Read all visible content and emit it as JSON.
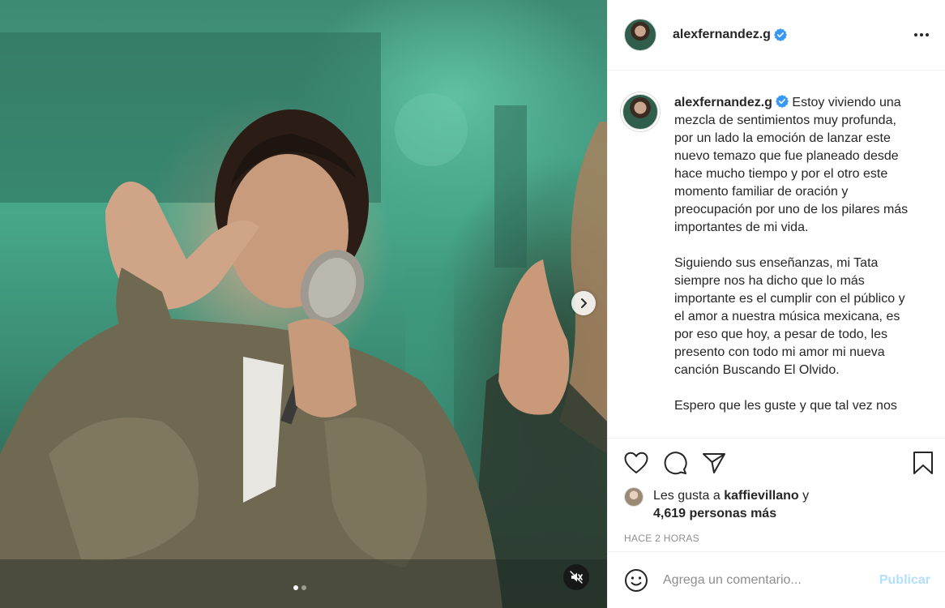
{
  "post": {
    "username": "alexfernandez.g",
    "verified": true,
    "media": {
      "type": "video-carousel",
      "slide_count": 2,
      "active_slide": 1
    },
    "caption": {
      "username": "alexfernandez.g",
      "paragraphs": [
        "Estoy viviendo una mezcla de sentimientos muy profunda, por un lado la emoción de lanzar este nuevo temazo que fue planeado desde hace mucho tiempo y por el otro este momento familiar de oración y preocupación por uno de los pilares más importantes de mi vida.",
        "Siguiendo sus enseñanzas, mi Tata siempre nos ha dicho que lo más importante es el cumplir con el público y el amor a nuestra música mexicana, es por eso que hoy, a pesar de todo, les presento con todo mi amor mi nueva canción Buscando El Olvido.",
        "Espero que les guste y que tal vez nos"
      ]
    },
    "likes": {
      "prefix": "Les gusta a",
      "first_user": "kaffievillano",
      "connector": "y",
      "others": "4,619 personas más"
    },
    "timestamp": "HACE 2 HORAS",
    "comment": {
      "placeholder": "Agrega un comentario...",
      "post_label": "Publicar"
    }
  },
  "colors": {
    "verified_badge": "#3897f0",
    "publish_disabled": "#b2dffc",
    "secondary_text": "#8e8e8e",
    "primary_text": "#262626"
  }
}
